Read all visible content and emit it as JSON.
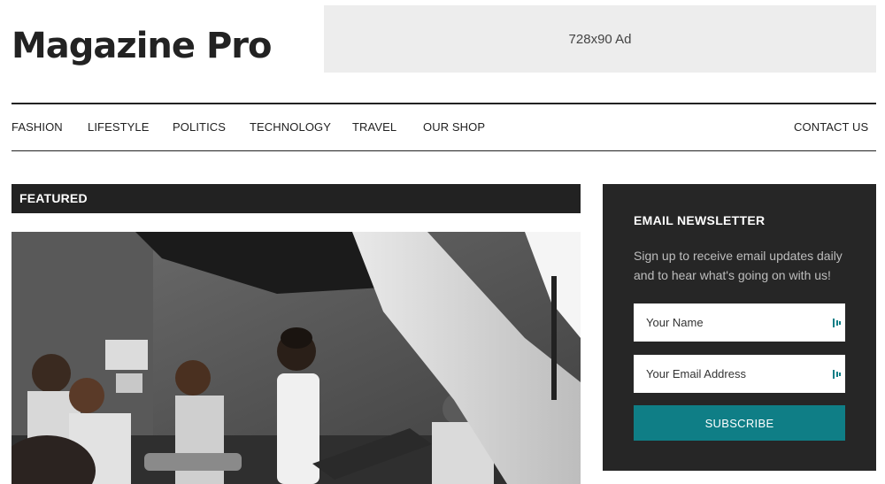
{
  "header": {
    "logo_text": "Magazine Pro",
    "ad_text": "728x90 Ad"
  },
  "nav": {
    "items": [
      {
        "label": "FASHION"
      },
      {
        "label": "LIFESTYLE"
      },
      {
        "label": "POLITICS"
      },
      {
        "label": "TECHNOLOGY"
      },
      {
        "label": "TRAVEL"
      },
      {
        "label": "OUR SHOP"
      }
    ],
    "contact_label": "CONTACT US"
  },
  "featured": {
    "heading": "FEATURED"
  },
  "newsletter": {
    "title": "EMAIL NEWSLETTER",
    "description": "Sign up to receive email updates daily and to hear what's going on with us!",
    "name_placeholder": "Your Name",
    "email_placeholder": "Your Email Address",
    "subscribe_label": "SUBSCRIBE",
    "field_icon": "password-manager-icon"
  },
  "colors": {
    "dark": "#222222",
    "newsletter_bg": "#262626",
    "accent": "#0f7e86",
    "ad_bg": "#ededed"
  }
}
